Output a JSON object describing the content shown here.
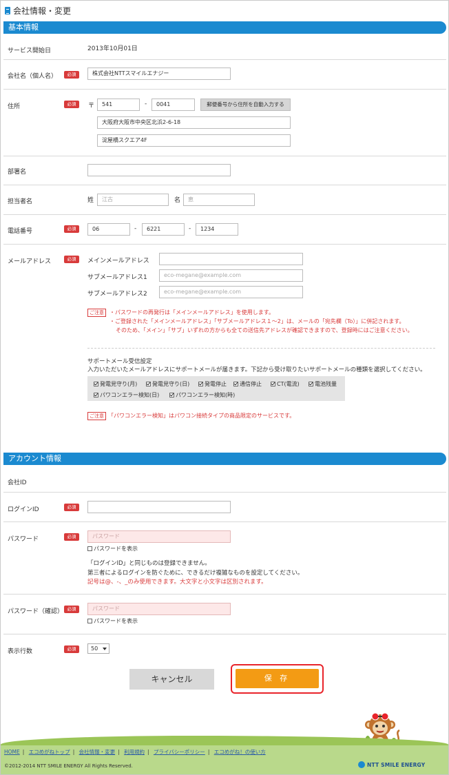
{
  "page_title": "会社情報・変更",
  "sections": {
    "basic": "基本情報",
    "account": "アカウント情報"
  },
  "required_badge": "必須",
  "caution_badge": "ご注意",
  "basic": {
    "service_start_label": "サービス開始日",
    "service_start_value": "2013年10月01日",
    "company_label": "会社名（個人名）",
    "company_value": "株式会社NTTスマイルエナジー",
    "address_label": "住所",
    "zip_mark": "〒",
    "zip1": "541",
    "zip_dash": "-",
    "zip2": "0041",
    "zip_button": "郵便番号から住所を自動入力する",
    "address1": "大阪府大阪市中央区北浜2-6-18",
    "address2": "淀屋橋スクエア4F",
    "department_label": "部署名",
    "department_value": "",
    "person_label": "担当者名",
    "last_name_label": "姓",
    "last_name_placeholder": "江古",
    "first_name_label": "名",
    "first_name_placeholder": "恵",
    "phone_label": "電話番号",
    "phone1": "06",
    "phone2": "6221",
    "phone3": "1234",
    "phone_dash": "-",
    "email_label": "メールアドレス",
    "main_email_label": "メインメールアドレス",
    "main_email_value": "",
    "sub_email1_label": "サブメールアドレス1",
    "sub_email1_placeholder": "eco-megane@example.com",
    "sub_email2_label": "サブメールアドレス2",
    "sub_email2_placeholder": "eco-megane@example.com",
    "email_notice1": "・パスワードの再発行は「メインメールアドレス」を使用します。",
    "email_notice2": "・ご登録された「メインメールアドレス」「サブメールアドレス１～2」は、メールの「宛先欄（To）」に併記されます。",
    "email_notice3": "そのため、「メイン」「サブ」いずれの方からも全ての送信先アドレスが確認できますので、登録時にはご注意ください。",
    "support_title": "サポートメール受信設定",
    "support_desc": "入力いただいたメールアドレスにサポートメールが届きます。下記から受け取りたいサポートメールの種類を選択してください。",
    "support_options": [
      {
        "label": "発電見守り(月)",
        "checked": true
      },
      {
        "label": "発電見守り(日)",
        "checked": true
      },
      {
        "label": "発電停止",
        "checked": true
      },
      {
        "label": "通信停止",
        "checked": true
      },
      {
        "label": "CT(電流)",
        "checked": true
      },
      {
        "label": "電池残量",
        "checked": true
      },
      {
        "label": "パワコンエラー検知(日)",
        "checked": true
      },
      {
        "label": "パワコンエラー検知(時)",
        "checked": true
      }
    ],
    "support_notice": "「パワコンエラー検知」はパワコン接続タイプの商品限定のサービスです。"
  },
  "account": {
    "company_id_label": "会社ID",
    "company_id_value": "",
    "login_id_label": "ログインID",
    "login_id_value": "",
    "password_label": "パスワード",
    "password_placeholder": "パスワード",
    "show_password_label": "パスワードを表示",
    "password_note1": "「ログインID」と同じものは登録できません。",
    "password_note2": "第三者によるログインを防ぐために、できるだけ複雑なものを設定してください。",
    "password_note3": "記号は@、-、_のみ使用できます。大文字と小文字は区別されます。",
    "password_confirm_label": "パスワード（確認）",
    "password_confirm_placeholder": "パスワード",
    "rows_label": "表示行数",
    "rows_value": "50"
  },
  "buttons": {
    "cancel": "キャンセル",
    "save": "保 存"
  },
  "footer": {
    "links": [
      "HOME",
      "エコめがねトップ",
      "会社情報・変更",
      "利用規約",
      "プライバシーポリシー",
      "エコめがね！の使い方"
    ],
    "separator": "|",
    "copyright": "©2012-2014 NTT SMILE ENERGY All Rights Reserved.",
    "logo": "NTT SMILE ENERGY"
  },
  "colors": {
    "section_bar": "#1b8ad0",
    "required": "#d83a3a",
    "save": "#f39b14",
    "save_outline": "#e8232a",
    "footer": "#b9d98b"
  }
}
